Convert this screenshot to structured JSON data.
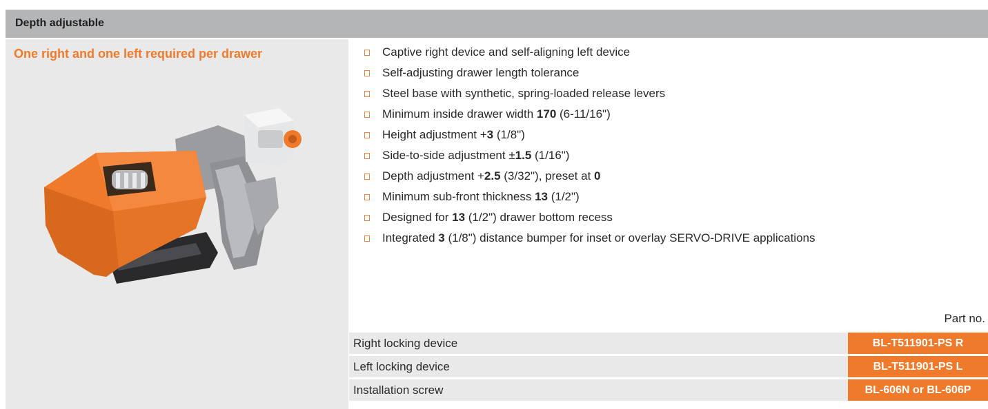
{
  "header": {
    "title": "Depth adjustable"
  },
  "left": {
    "subtitle": "One right and one left required per drawer"
  },
  "features": [
    {
      "parts": [
        {
          "t": "Captive right device and self-aligning left device"
        }
      ]
    },
    {
      "parts": [
        {
          "t": "Self-adjusting drawer length tolerance"
        }
      ]
    },
    {
      "parts": [
        {
          "t": "Steel base with synthetic, spring-loaded release levers"
        }
      ]
    },
    {
      "parts": [
        {
          "t": "Minimum inside drawer width "
        },
        {
          "t": "170",
          "b": true
        },
        {
          "t": " (6-11/16\")"
        }
      ]
    },
    {
      "parts": [
        {
          "t": "Height adjustment +"
        },
        {
          "t": "3",
          "b": true
        },
        {
          "t": " (1/8\")"
        }
      ]
    },
    {
      "parts": [
        {
          "t": "Side-to-side adjustment ±"
        },
        {
          "t": "1.5",
          "b": true
        },
        {
          "t": " (1/16\")"
        }
      ]
    },
    {
      "parts": [
        {
          "t": "Depth adjustment +"
        },
        {
          "t": "2.5",
          "b": true
        },
        {
          "t": " (3/32\"), preset at "
        },
        {
          "t": "0",
          "b": true
        }
      ]
    },
    {
      "parts": [
        {
          "t": "Minimum sub-front thickness "
        },
        {
          "t": "13",
          "b": true
        },
        {
          "t": " (1/2\")"
        }
      ]
    },
    {
      "parts": [
        {
          "t": "Designed for "
        },
        {
          "t": "13",
          "b": true
        },
        {
          "t": " (1/2\") drawer bottom recess"
        }
      ]
    },
    {
      "parts": [
        {
          "t": "Integrated "
        },
        {
          "t": "3",
          "b": true
        },
        {
          "t": " (1/8\") distance bumper for inset or overlay SERVO-DRIVE  applications"
        }
      ]
    }
  ],
  "table": {
    "part_no_label": "Part no.",
    "rows": [
      {
        "name": "Right locking device",
        "part": "BL-T511901-PS R"
      },
      {
        "name": "Left locking device",
        "part": "BL-T511901-PS L"
      },
      {
        "name": "Installation screw",
        "part": "BL-606N or BL-606P"
      }
    ]
  },
  "colors": {
    "accent": "#ef7a2b",
    "header_bg": "#b4b5b7",
    "panel_bg": "#e9e9ea"
  }
}
